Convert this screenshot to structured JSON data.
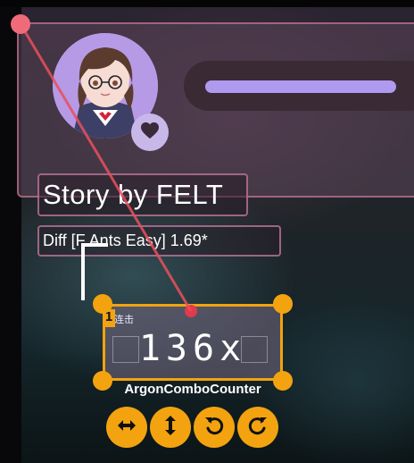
{
  "header": {
    "title": "Story by FELT",
    "difficulty": "Diff [F Ants Easy] 1.69*",
    "progress_fraction": 0.93
  },
  "component": {
    "index": "1",
    "label": "连击",
    "value": "136x",
    "name": "ArgonComboCounter"
  },
  "controls": [
    {
      "name": "flip-horizontal-icon"
    },
    {
      "name": "flip-vertical-icon"
    },
    {
      "name": "rotate-ccw-icon"
    },
    {
      "name": "rotate-cw-icon"
    }
  ],
  "colors": {
    "accent": "#f2a30f",
    "progress": "#b09af0",
    "panel_border": "#d282aa",
    "pointer": "#f06b7a"
  }
}
